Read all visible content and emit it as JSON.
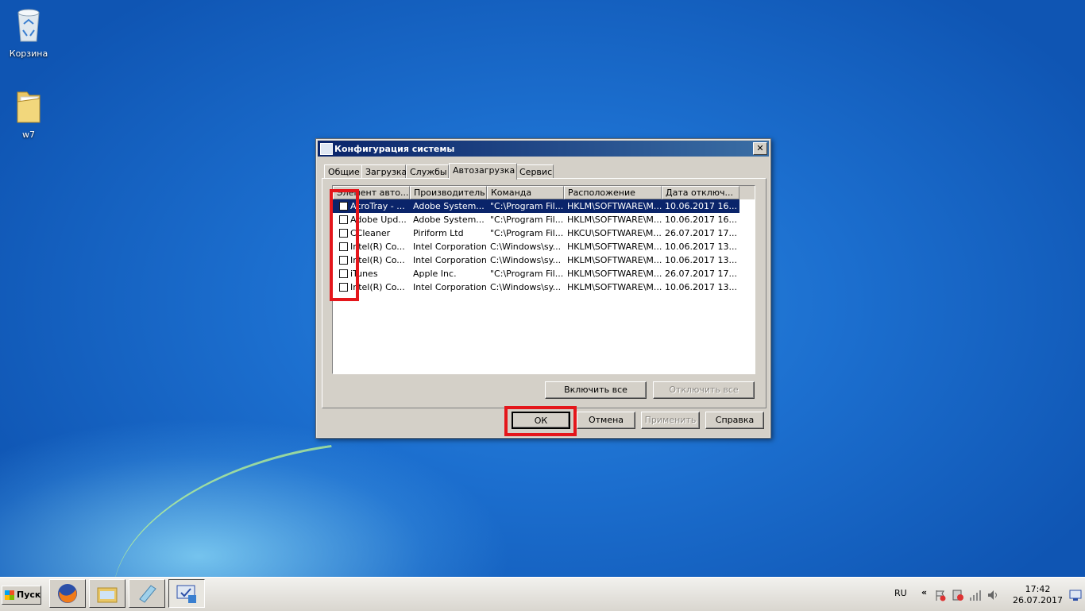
{
  "desktop": {
    "icons": [
      {
        "label": "Корзина"
      },
      {
        "label": "w7"
      }
    ]
  },
  "dialog": {
    "title": "Конфигурация системы",
    "close_label": "✕",
    "tabs": [
      {
        "label": "Общие"
      },
      {
        "label": "Загрузка"
      },
      {
        "label": "Службы"
      },
      {
        "label": "Автозагрузка"
      },
      {
        "label": "Сервис"
      }
    ],
    "active_tab": "Автозагрузка",
    "list": {
      "columns": [
        "Элемент авто...",
        "Производитель",
        "Команда",
        "Расположение",
        "Дата отключ..."
      ],
      "rows": [
        {
          "item": "AcroTray - ...",
          "maker": "Adobe System...",
          "command": "\"C:\\Program Fil...",
          "location": "HKLM\\SOFTWARE\\M...",
          "date": "10.06.2017 16...",
          "checked": false,
          "selected": true
        },
        {
          "item": "Adobe Upd...",
          "maker": "Adobe System...",
          "command": "\"C:\\Program Fil...",
          "location": "HKLM\\SOFTWARE\\M...",
          "date": "10.06.2017 16...",
          "checked": false,
          "selected": false
        },
        {
          "item": "CCleaner",
          "maker": "Piriform Ltd",
          "command": "\"C:\\Program Fil...",
          "location": "HKCU\\SOFTWARE\\M...",
          "date": "26.07.2017 17...",
          "checked": false,
          "selected": false
        },
        {
          "item": "Intel(R) Co...",
          "maker": "Intel Corporation",
          "command": "C:\\Windows\\sy...",
          "location": "HKLM\\SOFTWARE\\M...",
          "date": "10.06.2017 13...",
          "checked": false,
          "selected": false
        },
        {
          "item": "Intel(R) Co...",
          "maker": "Intel Corporation",
          "command": "C:\\Windows\\sy...",
          "location": "HKLM\\SOFTWARE\\M...",
          "date": "10.06.2017 13...",
          "checked": false,
          "selected": false
        },
        {
          "item": "iTunes",
          "maker": "Apple Inc.",
          "command": "\"C:\\Program Fil...",
          "location": "HKLM\\SOFTWARE\\M...",
          "date": "26.07.2017 17...",
          "checked": false,
          "selected": false
        },
        {
          "item": "Intel(R) Co...",
          "maker": "Intel Corporation",
          "command": "C:\\Windows\\sy...",
          "location": "HKLM\\SOFTWARE\\M...",
          "date": "10.06.2017 13...",
          "checked": false,
          "selected": false
        }
      ]
    },
    "enable_all_label": "Включить все",
    "disable_all_label": "Отключить все",
    "ok_label": "ОК",
    "cancel_label": "Отмена",
    "apply_label": "Применить",
    "help_label": "Справка"
  },
  "taskbar": {
    "start_label": "Пуск",
    "language": "RU",
    "tray_expand": "«",
    "time": "17:42",
    "date": "26.07.2017"
  },
  "colors": {
    "highlight": "#e4161b",
    "selection": "#0a246a",
    "title_start": "#0a246a",
    "title_end": "#3a6ea5"
  }
}
